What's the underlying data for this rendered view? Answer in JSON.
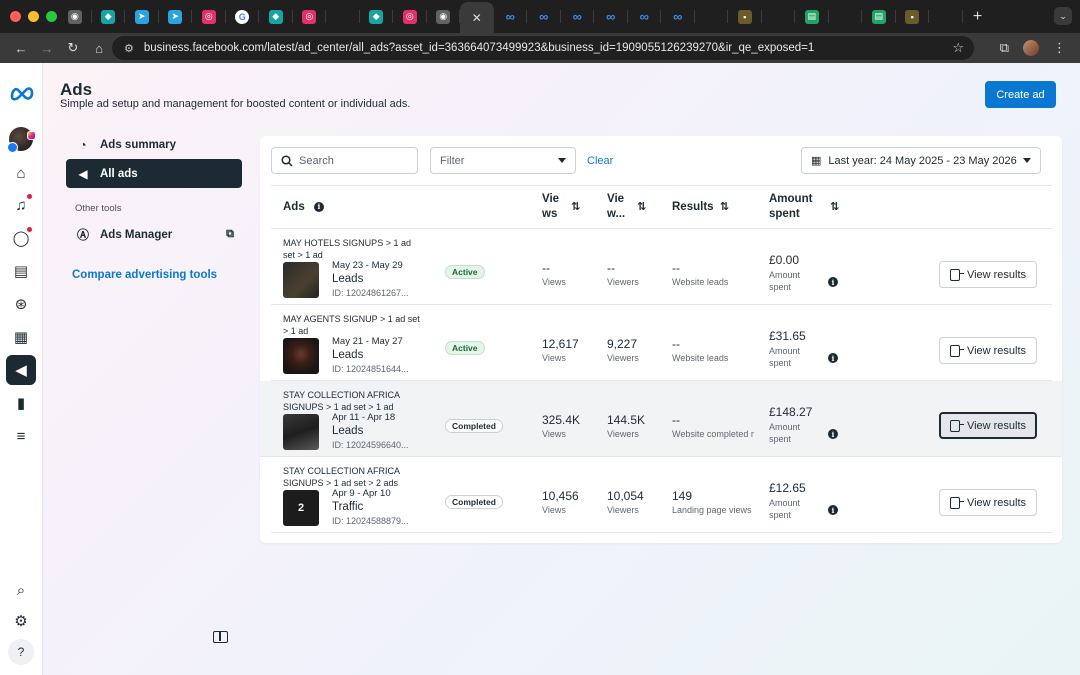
{
  "browser": {
    "url": "business.facebook.com/latest/ad_center/all_ads?asset_id=363664073499923&business_id=1909055126239270&ir_qe_exposed=1",
    "tabs": [
      {
        "icon": "chrome-icon",
        "color": "#5f6368"
      },
      {
        "icon": "app-icon",
        "color": "#1aa3a3"
      },
      {
        "icon": "telegram-icon",
        "color": "#2aa3e0"
      },
      {
        "icon": "telegram-icon",
        "color": "#2aa3e0"
      },
      {
        "icon": "instagram-icon",
        "color": "#e1306c"
      },
      {
        "icon": "google-icon",
        "color": "#ffffff"
      },
      {
        "icon": "app-icon",
        "color": "#1aa3a3"
      },
      {
        "icon": "instagram-icon",
        "color": "#e1306c"
      },
      {
        "icon": "blank-icon",
        "color": "#1f1f1f"
      },
      {
        "icon": "app-icon",
        "color": "#1aa3a3"
      },
      {
        "icon": "instagram-icon",
        "color": "#e1306c"
      },
      {
        "icon": "chrome-icon",
        "color": "#5f6368"
      },
      {
        "icon": "close-icon",
        "color": "#3a3a3a",
        "active": true
      },
      {
        "icon": "meta-icon",
        "color": "#0a78d1"
      },
      {
        "icon": "meta-icon",
        "color": "#0a78d1"
      },
      {
        "icon": "meta-icon",
        "color": "#0a78d1"
      },
      {
        "icon": "meta-icon",
        "color": "#0a78d1"
      },
      {
        "icon": "meta-icon",
        "color": "#0a78d1"
      },
      {
        "icon": "meta-icon",
        "color": "#0a78d1"
      },
      {
        "icon": "blank-icon",
        "color": "#1f1f1f"
      },
      {
        "icon": "site-icon",
        "color": "#6b5a2a"
      },
      {
        "icon": "blank-icon",
        "color": "#1f1f1f"
      },
      {
        "icon": "excel-icon",
        "color": "#21a366"
      },
      {
        "icon": "blank-icon",
        "color": "#1f1f1f"
      },
      {
        "icon": "excel-icon",
        "color": "#21a366"
      },
      {
        "icon": "site-icon",
        "color": "#6b5a2a"
      },
      {
        "icon": "blank-icon",
        "color": "#1f1f1f"
      }
    ]
  },
  "header": {
    "title": "Ads",
    "subtitle": "Simple ad setup and management for boosted content or individual ads.",
    "create_label": "Create ad"
  },
  "leftnav": {
    "ads_summary": "Ads summary",
    "all_ads": "All ads",
    "section": "Other tools",
    "ads_manager": "Ads Manager",
    "compare": "Compare advertising tools"
  },
  "filters": {
    "search_placeholder": "Search",
    "filter_placeholder": "Filter",
    "clear": "Clear",
    "date_range": "Last year: 24 May 2025 - 23 May 2026"
  },
  "table": {
    "columns": {
      "ads": "Ads",
      "views_a": "Vie",
      "views_b": "ws",
      "viewers_a": "Vie",
      "viewers_b": "w...",
      "results": "Results",
      "amount_a": "Amount",
      "amount_b": "spent"
    },
    "rows": [
      {
        "title": "MAY HOTELS SIGNUPS > 1 ad set > 1 ad",
        "date": "May 23 - May 29",
        "type": "Leads",
        "id": "ID: 12024861267...",
        "status": "Active",
        "views": "--",
        "views_label": "Views",
        "viewers": "--",
        "viewers_label": "Viewers",
        "results": "--",
        "results_label": "Website leads",
        "amount": "£0.00",
        "amount_label": "Amount spent",
        "action": "View results"
      },
      {
        "title": "MAY AGENTS SIGNUP > 1 ad set > 1 ad",
        "date": "May 21 - May 27",
        "type": "Leads",
        "id": "ID: 12024851644...",
        "status": "Active",
        "views": "12,617",
        "views_label": "Views",
        "viewers": "9,227",
        "viewers_label": "Viewers",
        "results": "--",
        "results_label": "Website leads",
        "amount": "£31.65",
        "amount_label": "Amount spent",
        "action": "View results"
      },
      {
        "title": "STAY COLLECTION AFRICA SIGNUPS > 1 ad set > 1 ad",
        "date": "Apr 11 - Apr 18",
        "type": "Leads",
        "id": "ID: 12024596640...",
        "status": "Completed",
        "views": "325.4K",
        "views_label": "Views",
        "viewers": "144.5K",
        "viewers_label": "Viewers",
        "results": "--",
        "results_label": "Website completed r",
        "amount": "£148.27",
        "amount_label": "Amount spent",
        "action": "View results"
      },
      {
        "title": "STAY COLLECTION AFRICA SIGNUPS > 1 ad set > 2 ads",
        "date": "Apr 9 - Apr 10",
        "type": "Traffic",
        "id": "ID: 12024588879...",
        "status": "Completed",
        "thumb_count": "2",
        "views": "10,456",
        "views_label": "Views",
        "viewers": "10,054",
        "viewers_label": "Viewers",
        "results": "149",
        "results_label": "Landing page views",
        "amount": "£12.65",
        "amount_label": "Amount spent",
        "action": "View results"
      }
    ]
  },
  "colors": {
    "accent": "#0a78d1",
    "dark": "#1c2b33",
    "active_badge": "#e6f5e9"
  }
}
